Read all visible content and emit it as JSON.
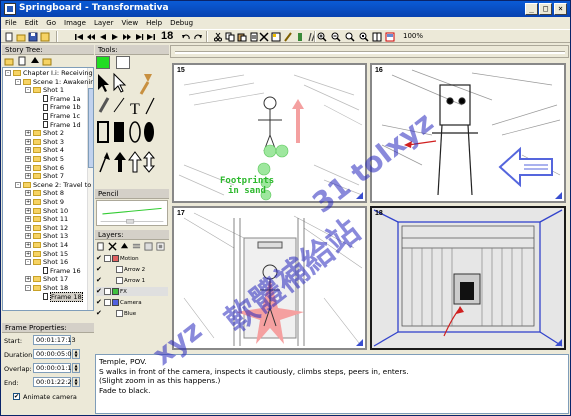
{
  "window": {
    "title": "Springboard - Transformativa",
    "controls": [
      "_",
      "□",
      "×"
    ]
  },
  "menu": [
    "File",
    "Edit",
    "Go",
    "Image",
    "Layer",
    "View",
    "Help",
    "Debug"
  ],
  "toolbar": {
    "frame_number": "18",
    "zoom": "100%"
  },
  "story_tree": {
    "header": "Story Tree:",
    "items": [
      {
        "label": "Chapter I.i: Receiving the",
        "depth": 0,
        "kind": "folder",
        "exp": "-"
      },
      {
        "label": "Scene 1: Awakening",
        "depth": 1,
        "kind": "folder",
        "exp": "-"
      },
      {
        "label": "Shot 1",
        "depth": 2,
        "kind": "folder",
        "exp": "-"
      },
      {
        "label": "Frame 1a",
        "depth": 3,
        "kind": "page"
      },
      {
        "label": "Frame 1b",
        "depth": 3,
        "kind": "page"
      },
      {
        "label": "Frame 1c",
        "depth": 3,
        "kind": "page"
      },
      {
        "label": "Frame 1d",
        "depth": 3,
        "kind": "page"
      },
      {
        "label": "Shot 2",
        "depth": 2,
        "kind": "folder",
        "exp": "+"
      },
      {
        "label": "Shot 3",
        "depth": 2,
        "kind": "folder",
        "exp": "+"
      },
      {
        "label": "Shot 4",
        "depth": 2,
        "kind": "folder",
        "exp": "+"
      },
      {
        "label": "Shot 5",
        "depth": 2,
        "kind": "folder",
        "exp": "+"
      },
      {
        "label": "Shot 6",
        "depth": 2,
        "kind": "folder",
        "exp": "+"
      },
      {
        "label": "Shot 7",
        "depth": 2,
        "kind": "folder",
        "exp": "+"
      },
      {
        "label": "Scene 2: Travel to the",
        "depth": 1,
        "kind": "folder",
        "exp": "-"
      },
      {
        "label": "Shot 8",
        "depth": 2,
        "kind": "folder",
        "exp": "+"
      },
      {
        "label": "Shot 9",
        "depth": 2,
        "kind": "folder",
        "exp": "+"
      },
      {
        "label": "Shot 10",
        "depth": 2,
        "kind": "folder",
        "exp": "+"
      },
      {
        "label": "Shot 11",
        "depth": 2,
        "kind": "folder",
        "exp": "+"
      },
      {
        "label": "Shot 12",
        "depth": 2,
        "kind": "folder",
        "exp": "+"
      },
      {
        "label": "Shot 13",
        "depth": 2,
        "kind": "folder",
        "exp": "+"
      },
      {
        "label": "Shot 14",
        "depth": 2,
        "kind": "folder",
        "exp": "+"
      },
      {
        "label": "Shot 15",
        "depth": 2,
        "kind": "folder",
        "exp": "+"
      },
      {
        "label": "Shot 16",
        "depth": 2,
        "kind": "folder",
        "exp": "-"
      },
      {
        "label": "Frame 16",
        "depth": 3,
        "kind": "page"
      },
      {
        "label": "Shot 17",
        "depth": 2,
        "kind": "folder",
        "exp": "+"
      },
      {
        "label": "Shot 18",
        "depth": 2,
        "kind": "folder",
        "exp": "-"
      },
      {
        "label": "Frame 18",
        "depth": 3,
        "kind": "page",
        "selected": true
      }
    ]
  },
  "frame_properties": {
    "header": "Frame Properties:",
    "start_label": "Start:",
    "start": "00:01:17:13",
    "duration_label": "Duration:",
    "duration": "00:00:05:07",
    "overlap_label": "Overlap:",
    "overlap": "00:00:01:13",
    "end_label": "End:",
    "end": "00:01:22:21",
    "animate_label": "Animate camera",
    "animate_checked": true
  },
  "tools": {
    "header": "Tools:",
    "primary_color": "#22dd22",
    "secondary_color": "#ffffff",
    "pencil_header": "Pencil"
  },
  "layers": {
    "header": "Layers:",
    "rows": [
      {
        "label": "Motion",
        "color": "#e06060",
        "visible": "✔",
        "indent": 0
      },
      {
        "label": "Arrow 2",
        "color": "",
        "visible": "✔",
        "indent": 1
      },
      {
        "label": "Arrow 1",
        "color": "",
        "visible": "✔",
        "indent": 1
      },
      {
        "label": "FX",
        "color": "#40c040",
        "visible": "✔",
        "indent": 0,
        "selected": true
      },
      {
        "label": "Camera",
        "color": "#5060e0",
        "visible": "✔",
        "indent": 0
      },
      {
        "label": "Blue",
        "color": "",
        "visible": "✔",
        "indent": 1
      }
    ]
  },
  "frames": [
    {
      "number": "15",
      "caption": "Footprints\nin sand"
    },
    {
      "number": "16",
      "caption": ""
    },
    {
      "number": "17",
      "caption": ""
    },
    {
      "number": "18",
      "caption": ""
    }
  ],
  "notes": {
    "lines": [
      "Temple, POV.",
      "S walks in front of the camera, inspects it cautiously, climbs steps, peers in, enters.",
      "(Slight zoom in as this happens.)",
      "Fade to black."
    ]
  },
  "watermarks": {
    "diagonal": "31 tolxyz",
    "chinese": "軟體補給站",
    "latin": "xyz"
  }
}
